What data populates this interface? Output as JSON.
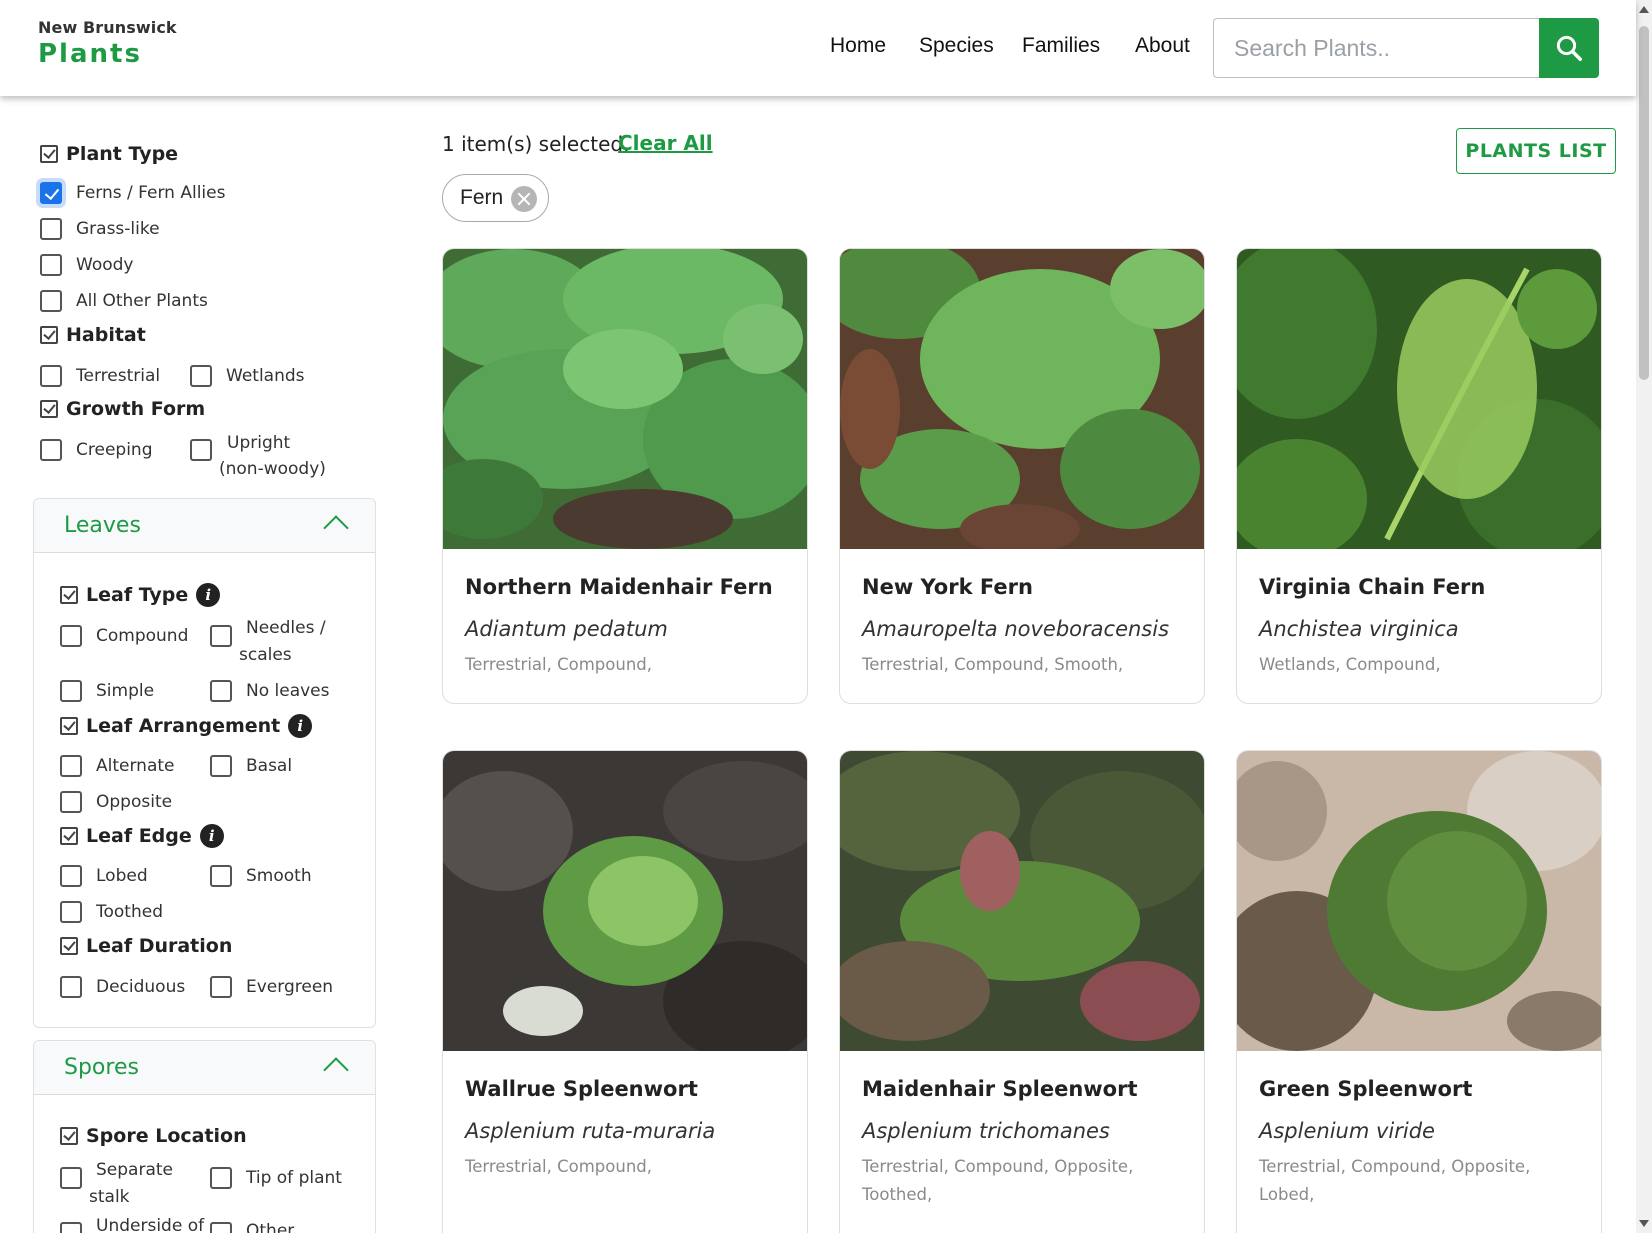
{
  "header": {
    "logo_top": "New Brunswick",
    "logo_main": "Plants",
    "nav": [
      "Home",
      "Species",
      "Families",
      "About"
    ],
    "search_placeholder": "Search Plants..",
    "search_icon": "search-icon"
  },
  "sidebar": {
    "plant_type": {
      "title": "Plant Type",
      "options": [
        {
          "label": "Ferns / Fern Allies",
          "checked": true
        },
        {
          "label": "Grass-like",
          "checked": false
        },
        {
          "label": "Woody",
          "checked": false
        },
        {
          "label": "All Other Plants",
          "checked": false
        }
      ]
    },
    "habitat": {
      "title": "Habitat",
      "options": [
        {
          "label": "Terrestrial",
          "checked": false
        },
        {
          "label": "Wetlands",
          "checked": false
        }
      ]
    },
    "growth_form": {
      "title": "Growth Form",
      "options": [
        {
          "label": "Creeping",
          "checked": false
        },
        {
          "label": "Upright",
          "label2": "(non-woody)",
          "checked": false
        }
      ]
    },
    "leaves_panel": {
      "title": "Leaves",
      "leaf_type": {
        "title": "Leaf Type",
        "options": [
          "Compound",
          "Needles /",
          "scales",
          "Simple",
          "No leaves"
        ]
      },
      "leaf_arrangement": {
        "title": "Leaf Arrangement",
        "options": [
          "Alternate",
          "Basal",
          "Opposite"
        ]
      },
      "leaf_edge": {
        "title": "Leaf Edge",
        "options": [
          "Lobed",
          "Smooth",
          "Toothed"
        ]
      },
      "leaf_duration": {
        "title": "Leaf Duration",
        "options": [
          "Deciduous",
          "Evergreen"
        ]
      }
    },
    "spores_panel": {
      "title": "Spores",
      "spore_location": {
        "title": "Spore Location",
        "options": [
          "Separate",
          "stalk",
          "Tip of plant",
          "Underside of",
          "Other"
        ]
      }
    },
    "info_icon_glyph": "i"
  },
  "main": {
    "selected_text": "1 item(s) selected.",
    "clear_all": "Clear All",
    "plants_list_button": "PLANTS LIST",
    "chip_label": "Fern"
  },
  "cards": [
    {
      "name": "Northern Maidenhair Fern",
      "scientific": "Adiantum pedatum",
      "tags": "Terrestrial,  Compound,"
    },
    {
      "name": "New York Fern",
      "scientific": "Amauropelta noveboracensis",
      "tags": "Terrestrial,  Compound,  Smooth,"
    },
    {
      "name": "Virginia Chain Fern",
      "scientific": "Anchistea virginica",
      "tags": "Wetlands,  Compound,"
    },
    {
      "name": "Wallrue Spleenwort",
      "scientific": "Asplenium ruta-muraria",
      "tags": "Terrestrial,  Compound,"
    },
    {
      "name": "Maidenhair Spleenwort",
      "scientific": "Asplenium trichomanes",
      "tags": "Terrestrial,  Compound,  Opposite,",
      "tags2": "Toothed,"
    },
    {
      "name": "Green Spleenwort",
      "scientific": "Asplenium viride",
      "tags": "Terrestrial,  Compound,  Opposite,",
      "tags2": "Lobed,"
    }
  ],
  "colors": {
    "brand_green": "#1e9a45",
    "checkbox_blue": "#1a73e8"
  }
}
